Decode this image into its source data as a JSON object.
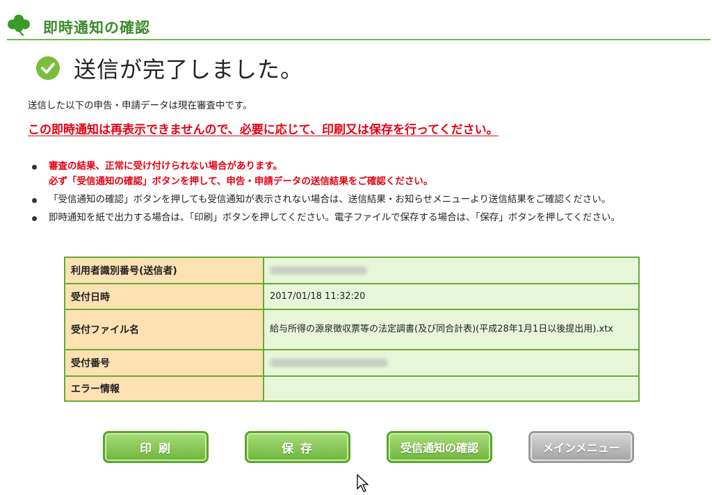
{
  "header": {
    "title": "即時通知の確認"
  },
  "status": {
    "completed_message": "送信が完了しました。"
  },
  "intro_text": "送信した以下の申告・申請データは現在審査中です。",
  "warning_text": "この即時通知は再表示できませんので、必要に応じて、印刷又は保存を行ってください。",
  "notes": [
    {
      "line1": "審査の結果、正常に受け付けられない場合があります。",
      "line2": "必ず「受信通知の確認」ボタンを押して、申告・申請データの送信結果をご確認ください。"
    },
    {
      "text": "「受信通知の確認」ボタンを押しても受信通知が表示されない場合は、送信結果・お知らせメニューより送信結果をご確認ください。"
    },
    {
      "text": "即時通知を紙で出力する場合は、「印刷」ボタンを押してください。電子ファイルで保存する場合は、「保存」ボタンを押してください。"
    }
  ],
  "table": {
    "rows": [
      {
        "label": "利用者識別番号(送信者)",
        "value": ""
      },
      {
        "label": "受付日時",
        "value": "2017/01/18 11:32:20"
      },
      {
        "label": "受付ファイル名",
        "value": "給与所得の源泉徴収票等の法定調書(及び同合計表)(平成28年1月1日以後提出用).xtx"
      },
      {
        "label": "受付番号",
        "value": ""
      },
      {
        "label": "エラー情報",
        "value": ""
      }
    ]
  },
  "buttons": {
    "print": "印 刷",
    "save": "保 存",
    "check_receipt": "受信通知の確認",
    "main_menu": "メインメニュー"
  },
  "colors": {
    "accent_green": "#6cb94a",
    "warning_red": "#e60012",
    "label_bg": "#fce1b3",
    "value_bg": "#e7f5d9"
  }
}
